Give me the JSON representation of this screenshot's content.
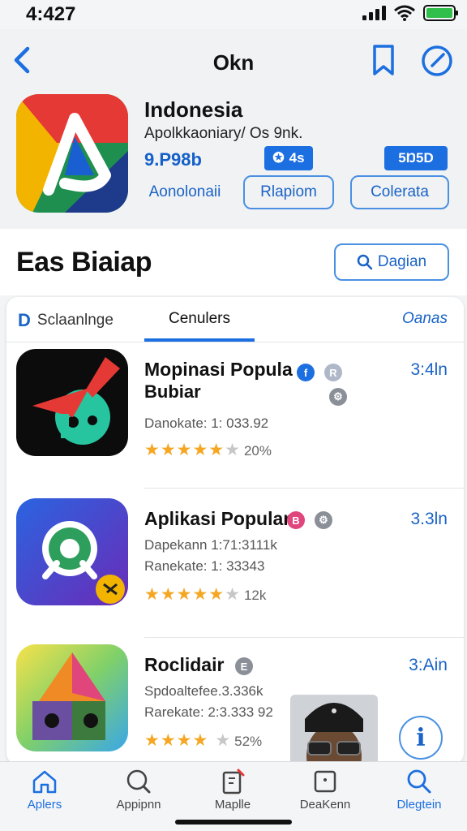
{
  "status": {
    "time": "4:427"
  },
  "nav": {
    "title": "Okn"
  },
  "hero": {
    "title": "Indonesia",
    "subtitle": "Apolkkaoniary/ Os 9nk.",
    "rating": "9.P98b",
    "chip_a": "4s",
    "chip_b": "5Ŋ5D",
    "pill_a": "Aonolonaii",
    "pill_b": "Rlapiom",
    "pill_c": "Colerata"
  },
  "section": {
    "title": "Eas Biaiap",
    "button": "Dagian"
  },
  "tabs": [
    {
      "label": "Sclaanlnge"
    },
    {
      "label": "Cenulers"
    },
    {
      "label": "Oanas"
    }
  ],
  "apps": [
    {
      "name_line1": "Mopinasi Popula",
      "name_line2": "Bubiar",
      "meta1": "Danokate: 1: 033.92",
      "meta2": "",
      "rating_stars": 5,
      "count": "20%",
      "size": "3:4ln",
      "badge_color": "#1c6fe0"
    },
    {
      "name_line1": "Aplikasi Popular",
      "name_line2": "",
      "meta1": "Dapekann 1:71:3111k",
      "meta2": "Ranekate: 1: 33343",
      "rating_stars": 5,
      "count": "12k",
      "size": "3.3ln",
      "badge_color": "#e0457b"
    },
    {
      "name_line1": "Roclidair",
      "name_line2": "",
      "meta1": "Spdoaltefee.3.336k",
      "meta2": "Rarekate: 2:3.333 92",
      "rating_stars": 4,
      "count": "52%",
      "size": "3:Ain",
      "badge_color": "#8a8f98"
    }
  ],
  "tabbar": [
    {
      "label": "Aplers",
      "icon": "home-icon",
      "active": true
    },
    {
      "label": "Appipnn",
      "icon": "search-chat-icon",
      "active": false
    },
    {
      "label": "Maplle",
      "icon": "clipboard-icon",
      "active": false
    },
    {
      "label": "DeaKenn",
      "icon": "inbox-icon",
      "active": false
    },
    {
      "label": "Dlegtein",
      "icon": "search-icon",
      "active": true
    }
  ],
  "colors": {
    "accent": "#1c6fe0",
    "star": "#f5a623"
  }
}
